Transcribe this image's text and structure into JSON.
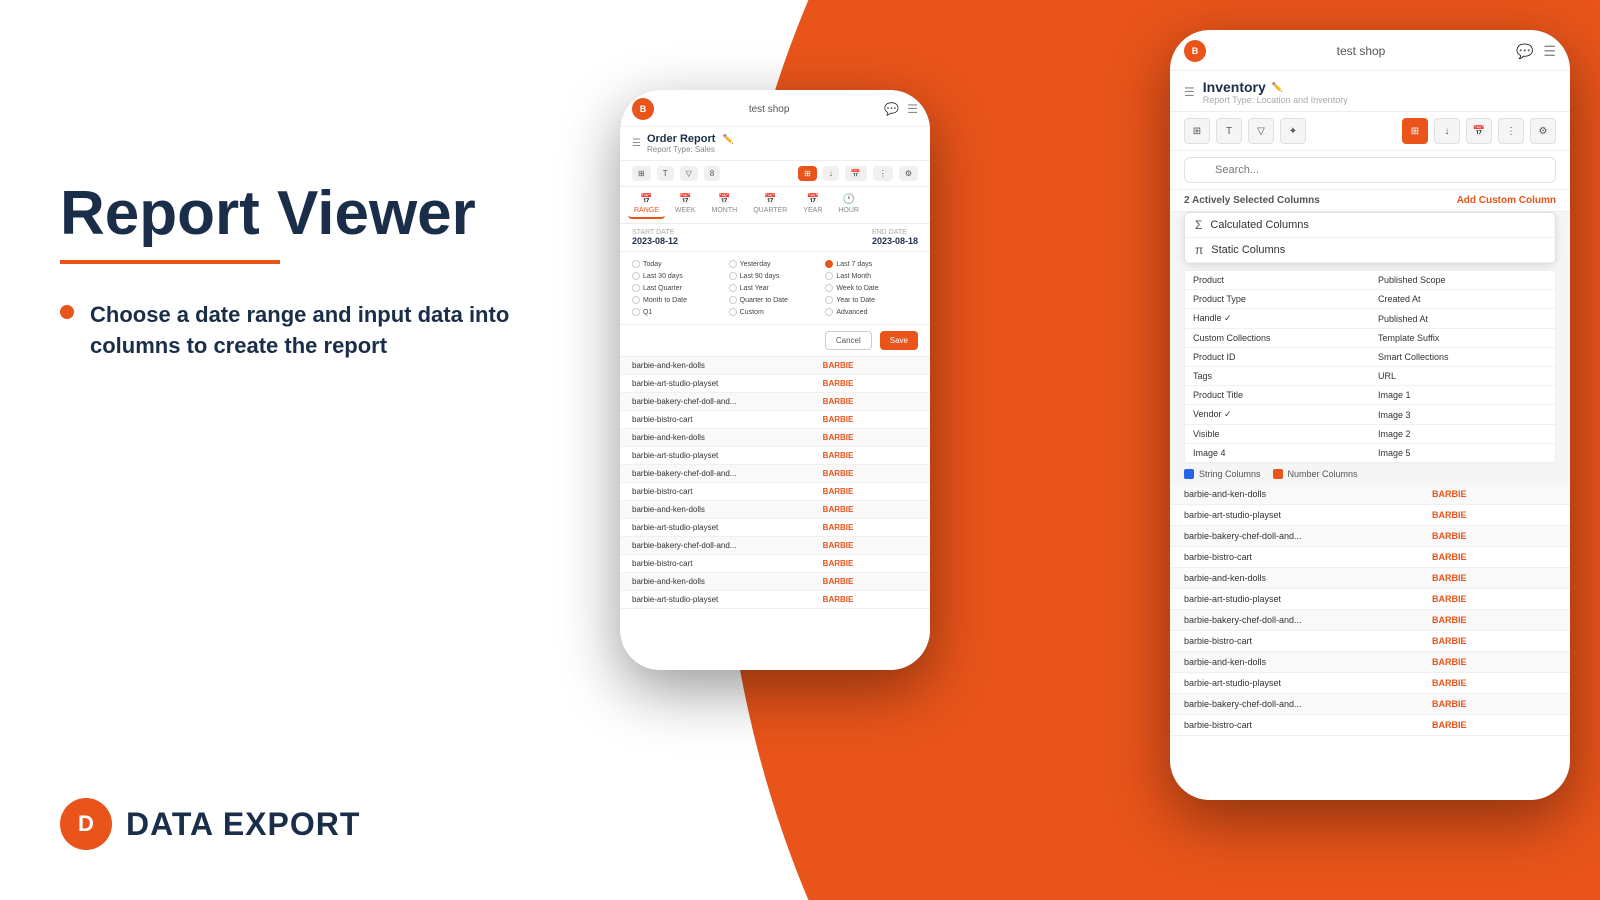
{
  "background": {
    "color": "#E8541A"
  },
  "left": {
    "title": "Report Viewer",
    "underline_color": "#E8541A",
    "bullet": "Choose a date range and input data into columns to create the report",
    "brand": {
      "name": "DATA EXPORT",
      "icon_letter": "D"
    }
  },
  "phone1": {
    "shop_name": "test shop",
    "title": "Order Report",
    "subtitle": "Report Type: Sales",
    "tabs": [
      "RANGE",
      "WEEK",
      "MONTH",
      "QUARTER",
      "YEAR",
      "HOUR"
    ],
    "active_tab": "RANGE",
    "start_date_label": "START DATE",
    "start_date": "2023-08-12",
    "end_date_label": "END DATE",
    "end_date": "2023-08-18",
    "radio_options": [
      "Today",
      "Yesterday",
      "Last 7 days",
      "Last 30 days",
      "Last 90 days",
      "Last Month",
      "Last Quarter",
      "Last Year",
      "Week to Date",
      "Month to Date",
      "Quarter to Date",
      "Year to Date",
      "Q1",
      "Custom",
      "Advanced"
    ],
    "selected_radio": "Last 7 days",
    "cancel_label": "Cancel",
    "save_label": "Save",
    "table_rows": [
      {
        "col1": "barbie-and-ken-dolls",
        "col2": "BARBIE"
      },
      {
        "col1": "barbie-art-studio-playset",
        "col2": "BARBIE"
      },
      {
        "col1": "barbie-bakery-chef-doll-and...",
        "col2": "BARBIE"
      },
      {
        "col1": "barbie-bistro-cart",
        "col2": "BARBIE"
      },
      {
        "col1": "barbie-and-ken-dolls",
        "col2": "BARBIE"
      },
      {
        "col1": "barbie-art-studio-playset",
        "col2": "BARBIE"
      },
      {
        "col1": "barbie-bakery-chef-doll-and...",
        "col2": "BARBIE"
      },
      {
        "col1": "barbie-bistro-cart",
        "col2": "BARBIE"
      },
      {
        "col1": "barbie-and-ken-dolls",
        "col2": "BARBIE"
      },
      {
        "col1": "barbie-art-studio-playset",
        "col2": "BARBIE"
      },
      {
        "col1": "barbie-bakery-chef-doll-and...",
        "col2": "BARBIE"
      },
      {
        "col1": "barbie-bistro-cart",
        "col2": "BARBIE"
      },
      {
        "col1": "barbie-and-ken-dolls",
        "col2": "BARBIE"
      },
      {
        "col1": "barbie-art-studio-playset",
        "col2": "BARBIE"
      }
    ]
  },
  "phone2": {
    "shop_name": "test shop",
    "title": "Inventory",
    "subtitle": "Report Type: Location and Inventory",
    "search_placeholder": "Search...",
    "active_columns_label": "2 Actively Selected Columns",
    "add_column_label": "Add Custom Column",
    "dropdown_items": [
      {
        "icon": "Σ",
        "label": "Calculated Columns"
      },
      {
        "icon": "π",
        "label": "Static Columns"
      }
    ],
    "columns": [
      {
        "name": "Product",
        "side": "left"
      },
      {
        "name": "Published Scope",
        "side": "right"
      },
      {
        "name": "Product Type",
        "side": "left"
      },
      {
        "name": "Created At",
        "side": "right"
      },
      {
        "name": "Handle ✓",
        "side": "left"
      },
      {
        "name": "Published At",
        "side": "right"
      },
      {
        "name": "Custom Collections",
        "side": "left"
      },
      {
        "name": "Template Suffix",
        "side": "right"
      },
      {
        "name": "Product ID",
        "side": "left"
      },
      {
        "name": "Smart Collections",
        "side": "right"
      },
      {
        "name": "Tags",
        "side": "left"
      },
      {
        "name": "URL",
        "side": "right"
      },
      {
        "name": "Product Title",
        "side": "left"
      },
      {
        "name": "Image 1",
        "side": "right"
      },
      {
        "name": "Vendor ✓",
        "side": "left"
      },
      {
        "name": "Image 3",
        "side": "right"
      },
      {
        "name": "Visible",
        "side": "left"
      },
      {
        "name": "Image 2",
        "side": "right"
      },
      {
        "name": "Image 4",
        "side": "left"
      },
      {
        "name": "Image 5",
        "side": "right"
      }
    ],
    "legend": {
      "string_label": "String Columns",
      "number_label": "Number Columns"
    },
    "table_rows": [
      {
        "col1": "barbie-and-ken-dolls",
        "col2": "BARBIE"
      },
      {
        "col1": "barbie-art-studio-playset",
        "col2": "BARBIE"
      },
      {
        "col1": "barbie-bakery-chef-doll-and...",
        "col2": "BARBIE"
      },
      {
        "col1": "barbie-bistro-cart",
        "col2": "BARBIE"
      },
      {
        "col1": "barbie-and-ken-dolls",
        "col2": "BARBIE"
      },
      {
        "col1": "barbie-art-studio-playset",
        "col2": "BARBIE"
      },
      {
        "col1": "barbie-bakery-chef-doll-and...",
        "col2": "BARBIE"
      },
      {
        "col1": "barbie-bistro-cart",
        "col2": "BARBIE"
      },
      {
        "col1": "barbie-and-ken-dolls",
        "col2": "BARBIE"
      },
      {
        "col1": "barbie-art-studio-playset",
        "col2": "BARBIE"
      },
      {
        "col1": "barbie-bakery-chef-doll-and...",
        "col2": "BARBIE"
      },
      {
        "col1": "barbie-bistro-cart",
        "col2": "BARBIE"
      }
    ]
  }
}
